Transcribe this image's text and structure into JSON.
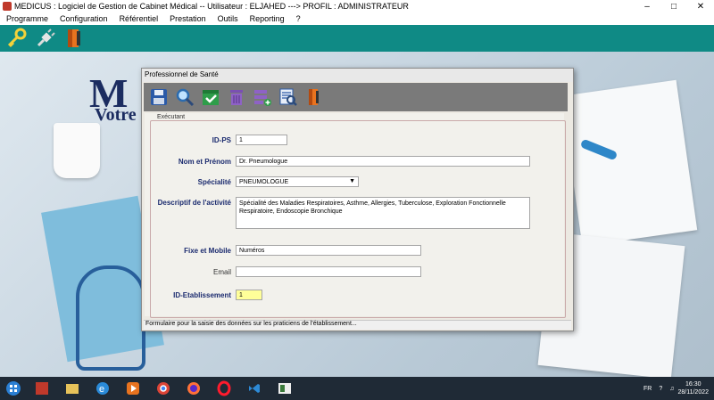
{
  "window": {
    "title": "MEDICUS : Logiciel de Gestion de Cabinet Médical -- Utilisateur : ELJAHED ---> PROFIL : ADMINISTRATEUR"
  },
  "menu": [
    "Programme",
    "Configuration",
    "Référentiel",
    "Prestation",
    "Outils",
    "Reporting",
    "?"
  ],
  "toolbar_icons": [
    "key-icon",
    "plug-icon",
    "exit-door-icon"
  ],
  "background": {
    "logo": "M",
    "logo_sub": "Votre"
  },
  "dialog": {
    "title": "Professionnel de Santé",
    "toolbar_icons": [
      "save-icon",
      "search-icon",
      "validate-icon",
      "delete-icon",
      "add-list-icon",
      "view-list-icon",
      "exit-door-icon"
    ],
    "section": "Exécutant",
    "fields": {
      "id_ps": {
        "label": "ID-PS",
        "value": "1"
      },
      "nom": {
        "label": "Nom et Prénom",
        "value": "Dr. Pneumologue"
      },
      "specialite": {
        "label": "Spécialité",
        "value": "PNEUMOLOGUE"
      },
      "descriptif": {
        "label": "Descriptif de l'activité",
        "value": "Spécialité des Maladies Respiratoires, Asthme, Allergies, Tuberculose, Exploration Fonctionnelle Respiratoire, Endoscopie Bronchique"
      },
      "telephone": {
        "label": "Fixe et Mobile",
        "value": "Numéros"
      },
      "email": {
        "label": "Email",
        "value": ""
      },
      "id_etab": {
        "label": "ID-Etablissement",
        "value": "1"
      }
    },
    "status": "Formulaire pour la saisie des données sur les praticiens de l'établissement..."
  },
  "taskbar": {
    "tray_lang": "FR",
    "time": "16:30",
    "date": "28/11/2022"
  },
  "colors": {
    "teal": "#0f8a85",
    "label_blue": "#1a2a6e",
    "taskbar": "#1f2a36"
  }
}
